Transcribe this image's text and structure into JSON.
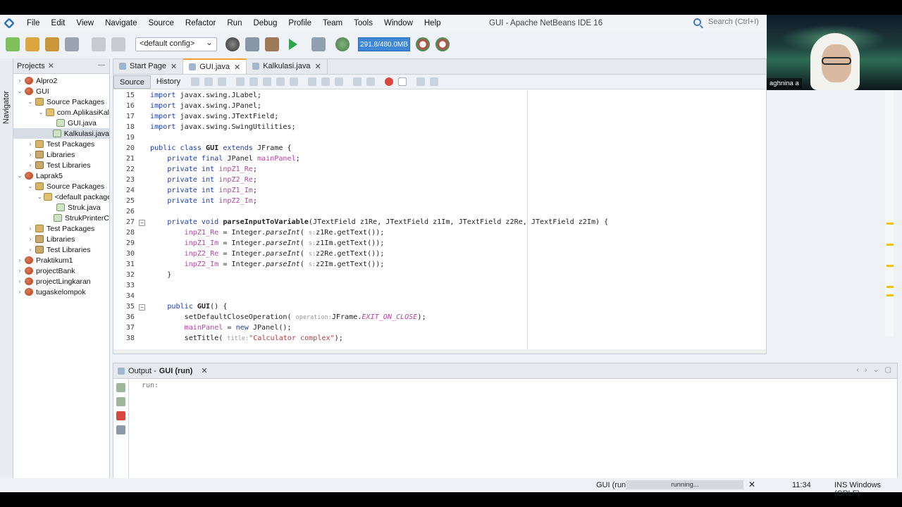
{
  "window": {
    "title": "GUI - Apache NetBeans IDE 16",
    "search_placeholder": "Search (Ctrl+I)"
  },
  "menu": [
    "File",
    "Edit",
    "View",
    "Navigate",
    "Source",
    "Refactor",
    "Run",
    "Debug",
    "Profile",
    "Team",
    "Tools",
    "Window",
    "Help"
  ],
  "toolbar": {
    "config": "<default config>",
    "memory": "291.8/480.0MB"
  },
  "navigator_label": "Navigator",
  "projects": {
    "tab_label": "Projects",
    "tree": [
      {
        "label": "Alpro2",
        "icon": "project-icon",
        "expanded": false,
        "indent": 0
      },
      {
        "label": "GUI",
        "icon": "project-icon",
        "expanded": true,
        "indent": 0
      },
      {
        "label": "Source Packages",
        "icon": "package-folder-icon",
        "expanded": true,
        "indent": 1
      },
      {
        "label": "com.AplikasiKal",
        "icon": "package-icon",
        "expanded": true,
        "indent": 2
      },
      {
        "label": "GUI.java",
        "icon": "java-file-icon",
        "expanded": null,
        "indent": 3
      },
      {
        "label": "Kalkulasi.java",
        "icon": "java-file-icon",
        "expanded": null,
        "indent": 3,
        "selected": true
      },
      {
        "label": "Test Packages",
        "icon": "package-folder-icon",
        "expanded": false,
        "indent": 1
      },
      {
        "label": "Libraries",
        "icon": "library-icon",
        "expanded": false,
        "indent": 1
      },
      {
        "label": "Test Libraries",
        "icon": "library-icon",
        "expanded": false,
        "indent": 1
      },
      {
        "label": "Laprak5",
        "icon": "project-icon",
        "expanded": true,
        "indent": 0
      },
      {
        "label": "Source Packages",
        "icon": "package-folder-icon",
        "expanded": true,
        "indent": 1
      },
      {
        "label": "<default package>",
        "icon": "package-icon",
        "expanded": true,
        "indent": 2
      },
      {
        "label": "Struk.java",
        "icon": "java-file-icon",
        "expanded": null,
        "indent": 3
      },
      {
        "label": "StrukPrinterC",
        "icon": "java-file-icon",
        "expanded": null,
        "indent": 3
      },
      {
        "label": "Test Packages",
        "icon": "package-folder-icon",
        "expanded": false,
        "indent": 1
      },
      {
        "label": "Libraries",
        "icon": "library-icon",
        "expanded": false,
        "indent": 1
      },
      {
        "label": "Test Libraries",
        "icon": "library-icon",
        "expanded": false,
        "indent": 1
      },
      {
        "label": "Praktikum1",
        "icon": "project-icon",
        "expanded": false,
        "indent": 0
      },
      {
        "label": "projectBank",
        "icon": "project-icon",
        "expanded": false,
        "indent": 0
      },
      {
        "label": "projectLingkaran",
        "icon": "project-icon",
        "expanded": false,
        "indent": 0
      },
      {
        "label": "tugaskelompok",
        "icon": "project-icon",
        "expanded": false,
        "indent": 0
      }
    ]
  },
  "editor": {
    "tabs": [
      {
        "label": "Start Page",
        "active": false
      },
      {
        "label": "GUI.java",
        "active": true
      },
      {
        "label": "Kalkulasi.java",
        "active": false
      }
    ],
    "source_label": "Source",
    "history_label": "History",
    "lines": [
      {
        "n": "15",
        "html": "<span class=\"kw\">import</span> javax.swing.JLabel;"
      },
      {
        "n": "16",
        "html": "<span class=\"kw\">import</span> javax.swing.JPanel;"
      },
      {
        "n": "17",
        "html": "<span class=\"kw\">import</span> javax.swing.JTextField;"
      },
      {
        "n": "18",
        "html": "<span class=\"kw\">import</span> javax.swing.SwingUtilities;"
      },
      {
        "n": "19",
        "html": ""
      },
      {
        "n": "20",
        "html": "<span class=\"kw\">public class</span> <b>GUI</b> <span class=\"kw\">extends</span> JFrame {"
      },
      {
        "n": "21",
        "html": "    <span class=\"kw\">private final</span> JPanel <span class=\"fld\">mainPanel</span>;"
      },
      {
        "n": "22",
        "html": "    <span class=\"kw\">private int</span> <span class=\"fld\">inpZ1_Re</span>;"
      },
      {
        "n": "23",
        "html": "    <span class=\"kw\">private int</span> <span class=\"fld\">inpZ2_Re</span>;"
      },
      {
        "n": "24",
        "html": "    <span class=\"kw\">private int</span> <span class=\"fld\">inpZ1_Im</span>;"
      },
      {
        "n": "25",
        "html": "    <span class=\"kw\">private int</span> <span class=\"fld\">inpZ2_Im</span>;"
      },
      {
        "n": "26",
        "html": ""
      },
      {
        "n": "27",
        "html": "    <span class=\"kw\">private void</span> <b>parseInputToVariable</b>(JTextField z1Re, JTextField z1Im, JTextField z2Re, JTextField z2Im) {"
      },
      {
        "n": "28",
        "html": "        <span class=\"fld\">inpZ1_Re</span> = Integer.<span class=\"it\">parseInt</span>( <span class=\"hint\">s:</span>z1Re.getText());"
      },
      {
        "n": "29",
        "html": "        <span class=\"fld\">inpZ1_Im</span> = Integer.<span class=\"it\">parseInt</span>( <span class=\"hint\">s:</span>z1Im.getText());"
      },
      {
        "n": "30",
        "html": "        <span class=\"fld\">inpZ2_Re</span> = Integer.<span class=\"it\">parseInt</span>( <span class=\"hint\">s:</span>z2Re.getText());"
      },
      {
        "n": "31",
        "html": "        <span class=\"fld\">inpZ2_Im</span> = Integer.<span class=\"it\">parseInt</span>( <span class=\"hint\">s:</span>z2Im.getText());"
      },
      {
        "n": "32",
        "html": "    }"
      },
      {
        "n": "33",
        "html": ""
      },
      {
        "n": "34",
        "html": ""
      },
      {
        "n": "35",
        "html": "    <span class=\"kw\">public</span> <b>GUI</b>() {"
      },
      {
        "n": "36",
        "html": "        setDefaultCloseOperation( <span class=\"hint\">operation:</span>JFrame.<span class=\"fld it\">EXIT_ON_CLOSE</span>);"
      },
      {
        "n": "37",
        "html": "        <span class=\"fld\">mainPanel</span> = <span class=\"kw\">new</span> JPanel();"
      },
      {
        "n": "38",
        "html": "        setTitle( <span class=\"hint\">title:</span><span class=\"str\">\"Calculator complex\"</span>);"
      }
    ]
  },
  "output": {
    "tab_label": "Output - ",
    "tab_bold": "GUI (run)",
    "text": "run:"
  },
  "status": {
    "run_label": "GUI (run)",
    "progress_text": "running...",
    "time": "11:34",
    "mode": "INS",
    "line_ending": "Windows (CRLF)"
  },
  "webcam": {
    "name": "aghnina a"
  },
  "colors": {
    "keyword": "#1f3fa8",
    "field": "#b345a6",
    "string": "#b34040",
    "memory_bar": "#3e86d6",
    "active_tab_accent": "#f0a030"
  }
}
